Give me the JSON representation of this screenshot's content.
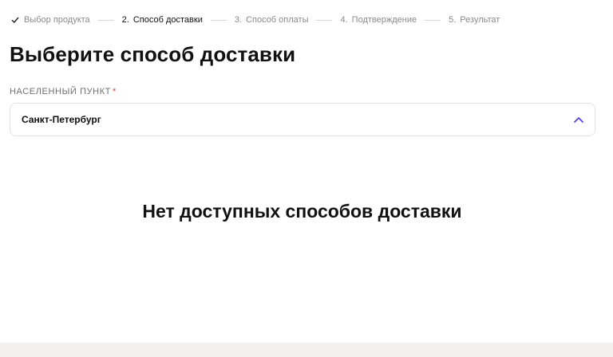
{
  "stepper": {
    "steps": [
      {
        "label": "Выбор продукта",
        "num": "",
        "state": "completed"
      },
      {
        "label": "Способ доставки",
        "num": "2.",
        "state": "active"
      },
      {
        "label": "Способ оплаты",
        "num": "3.",
        "state": "pending"
      },
      {
        "label": "Подтверждение",
        "num": "4.",
        "state": "pending"
      },
      {
        "label": "Результат",
        "num": "5.",
        "state": "pending"
      }
    ]
  },
  "page": {
    "title": "Выберите способ доставки"
  },
  "locality": {
    "label": "НАСЕЛЕННЫЙ ПУНКТ",
    "required_mark": "*",
    "value": "Санкт-Петербург"
  },
  "empty_state": {
    "message": "Нет доступных способов доставки"
  },
  "colors": {
    "accent": "#5b3df5",
    "required": "#e53935",
    "footer_bg": "#f1f0ee"
  },
  "icons": {
    "completed_step": "check-icon",
    "dropdown": "chevron-up-icon"
  }
}
